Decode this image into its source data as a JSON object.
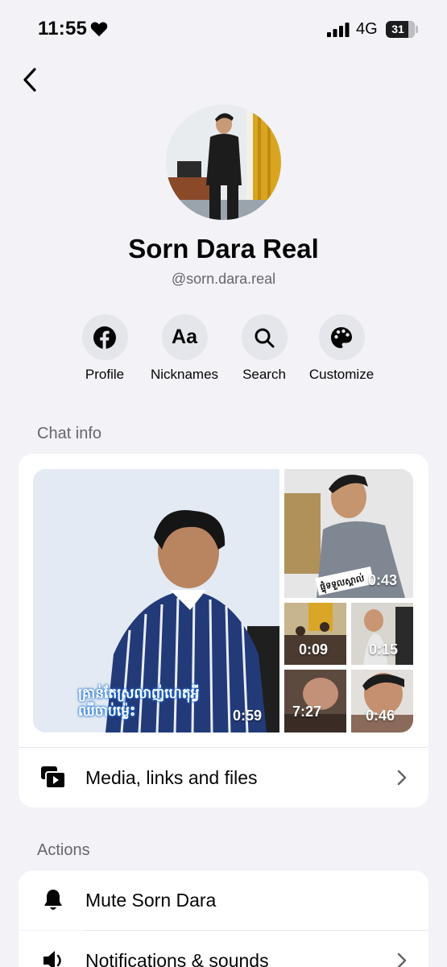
{
  "status_bar": {
    "time": "11:55",
    "network": "4G",
    "battery": "31"
  },
  "profile": {
    "name": "Sorn Dara Real",
    "handle": "@sorn.dara.real"
  },
  "actions_row": [
    {
      "label": "Profile",
      "icon": "facebook-icon"
    },
    {
      "label": "Nicknames",
      "icon": "aa-text-icon"
    },
    {
      "label": "Search",
      "icon": "search-icon"
    },
    {
      "label": "Customize",
      "icon": "palette-icon"
    }
  ],
  "chat_info": {
    "title": "Chat info",
    "media": [
      {
        "duration": "0:59",
        "caption": "គ្រាន់តែស្រលាញ់ហេតុអ្វី ឈឺចាប់ម្ល៉េះ"
      },
      {
        "duration": "0:43",
        "caption": "ផ្ទុំទទួលស្គាល់"
      },
      {
        "duration": "0:09"
      },
      {
        "duration": "0:15"
      },
      {
        "duration": "7:27"
      },
      {
        "duration": "0:46"
      }
    ],
    "media_link_label": "Media, links and files"
  },
  "actions": {
    "title": "Actions",
    "mute_label": "Mute Sorn Dara",
    "notifications_label": "Notifications & sounds"
  },
  "colors": {
    "background": "#f2f2f7",
    "card": "#ffffff",
    "icon_circle": "#e4e6eb",
    "secondary_text": "#65676b"
  }
}
